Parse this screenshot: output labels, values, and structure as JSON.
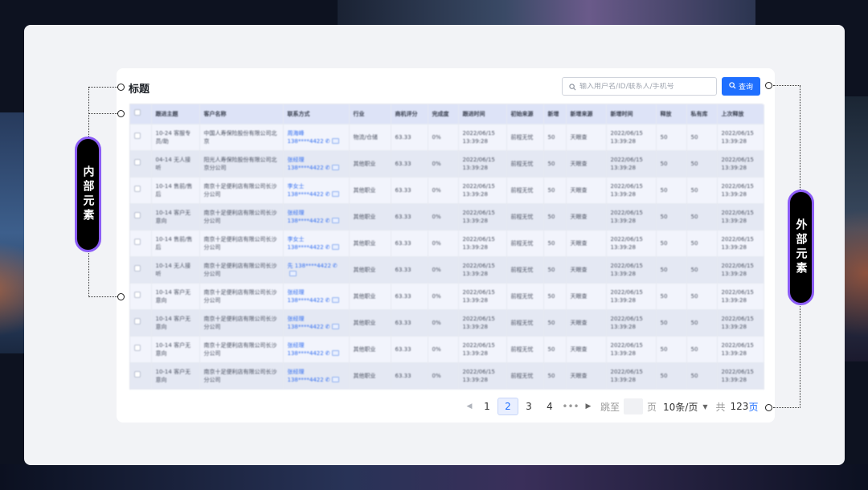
{
  "card": {
    "title": "标题",
    "search_placeholder": "输入用户名/ID/联系人/手机号",
    "search_button": "查询"
  },
  "table": {
    "headers": [
      "",
      "跟进主题",
      "客户名称",
      "联系方式",
      "行业",
      "商机评分",
      "完成度",
      "跟进时间",
      "初始来源",
      "新增",
      "新增来源",
      "新增时间",
      "释放",
      "私有库",
      "上次释放"
    ],
    "rows": [
      [
        "",
        "10-24 客服专员/助",
        "中国人寿保险股份有限公司北京",
        "周海峰 138****4422",
        "物流/仓储",
        "63.33",
        "0%",
        "2022/06/15 13:39:28",
        "前程无忧",
        "50",
        "天眼查",
        "2022/06/15 13:39:28",
        "50",
        "50",
        "2022/06/15 13:39:28"
      ],
      [
        "",
        "04-14 无人接听",
        "阳光人寿保险股份有限公司北京分公司",
        "张经理 138****4422",
        "其他职业",
        "63.33",
        "0%",
        "2022/06/15 13:39:28",
        "前程无忧",
        "50",
        "天眼查",
        "2022/06/15 13:39:28",
        "50",
        "50",
        "2022/06/15 13:39:28"
      ],
      [
        "",
        "10-14 售前/售后",
        "南京十足便利店有限公司长沙分公司",
        "李女士 138****4422",
        "其他职业",
        "63.33",
        "0%",
        "2022/06/15 13:39:28",
        "前程无忧",
        "50",
        "天眼查",
        "2022/06/15 13:39:28",
        "50",
        "50",
        "2022/06/15 13:39:28"
      ],
      [
        "",
        "10-14 客户无意向",
        "南京十足便利店有限公司长沙分公司",
        "张经理 138****4422",
        "其他职业",
        "63.33",
        "0%",
        "2022/06/15 13:39:28",
        "前程无忧",
        "50",
        "天眼查",
        "2022/06/15 13:39:28",
        "50",
        "50",
        "2022/06/15 13:39:28"
      ],
      [
        "",
        "10-14 售前/售后",
        "南京十足便利店有限公司长沙分公司",
        "李女士 138****4422",
        "其他职业",
        "63.33",
        "0%",
        "2022/06/15 13:39:28",
        "前程无忧",
        "50",
        "天眼查",
        "2022/06/15 13:39:28",
        "50",
        "50",
        "2022/06/15 13:39:28"
      ],
      [
        "",
        "10-14 无人接听",
        "南京十足便利店有限公司长沙分公司",
        "先 138****4422",
        "其他职业",
        "63.33",
        "0%",
        "2022/06/15 13:39:28",
        "前程无忧",
        "50",
        "天眼查",
        "2022/06/15 13:39:28",
        "50",
        "50",
        "2022/06/15 13:39:28"
      ],
      [
        "",
        "10-14 客户无意向",
        "南京十足便利店有限公司长沙分公司",
        "张经理 138****4422",
        "其他职业",
        "63.33",
        "0%",
        "2022/06/15 13:39:28",
        "前程无忧",
        "50",
        "天眼查",
        "2022/06/15 13:39:28",
        "50",
        "50",
        "2022/06/15 13:39:28"
      ],
      [
        "",
        "10-14 客户无意向",
        "南京十足便利店有限公司长沙分公司",
        "张经理 138****4422",
        "其他职业",
        "63.33",
        "0%",
        "2022/06/15 13:39:28",
        "前程无忧",
        "50",
        "天眼查",
        "2022/06/15 13:39:28",
        "50",
        "50",
        "2022/06/15 13:39:28"
      ],
      [
        "",
        "10-14 客户无意向",
        "南京十足便利店有限公司长沙分公司",
        "张经理 138****4422",
        "其他职业",
        "63.33",
        "0%",
        "2022/06/15 13:39:28",
        "前程无忧",
        "50",
        "天眼查",
        "2022/06/15 13:39:28",
        "50",
        "50",
        "2022/06/15 13:39:28"
      ],
      [
        "",
        "10-14 客户无意向",
        "南京十足便利店有限公司长沙分公司",
        "张经理 138****4422",
        "其他职业",
        "63.33",
        "0%",
        "2022/06/15 13:39:28",
        "前程无忧",
        "50",
        "天眼查",
        "2022/06/15 13:39:28",
        "50",
        "50",
        "2022/06/15 13:39:28"
      ]
    ]
  },
  "pagination": {
    "pages": [
      "1",
      "2",
      "3",
      "4"
    ],
    "active": "2",
    "ellipsis": "•••",
    "jump_label": "跳至",
    "page_unit": "页",
    "per_page": "10条/页",
    "total_label": "共",
    "total_num": "123",
    "total_unit": "页"
  },
  "annotations": {
    "inner": "内部元素",
    "outer": "外部元素"
  },
  "colors": {
    "accent": "#1f6fff",
    "pill_border": "#8b5cf6"
  }
}
